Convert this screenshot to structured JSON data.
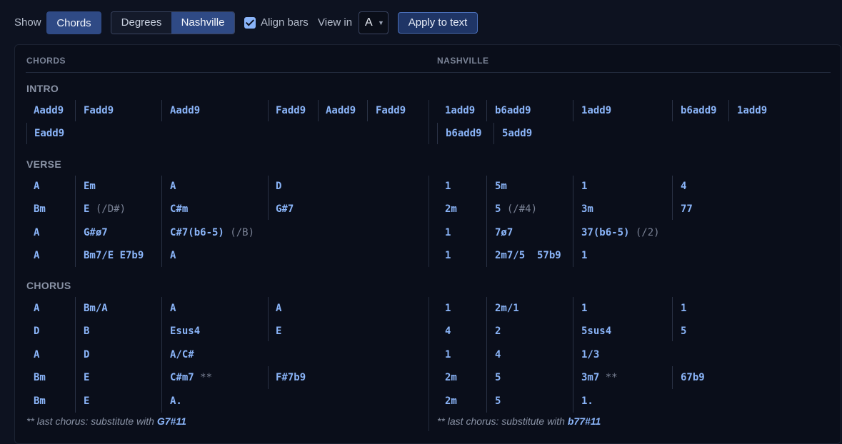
{
  "toolbar": {
    "show_label": "Show",
    "chords_button": "Chords",
    "degrees_button": "Degrees",
    "nashville_button": "Nashville",
    "align_bars_label": "Align bars",
    "align_bars_checked": true,
    "view_in_label": "View in",
    "view_in_value": "A",
    "apply_button": "Apply to text"
  },
  "columns": {
    "left": "CHORDS",
    "right": "NASHVILLE"
  },
  "sections": {
    "intro": "INTRO",
    "verse": "VERSE",
    "chorus": "CHORUS"
  },
  "chords": {
    "intro": [
      [
        "Aadd9",
        "Fadd9",
        "Aadd9",
        "Fadd9",
        "Aadd9",
        "Fadd9"
      ],
      [
        "Eadd9"
      ]
    ],
    "verse": [
      [
        "A",
        "Em",
        "A",
        "D"
      ],
      [
        "Bm",
        "E",
        "(/D#)",
        "C#m",
        "G#7"
      ],
      [
        "A",
        "G#ø7",
        "C#7(b6-5)",
        "(/B)"
      ],
      [
        "A",
        "Bm7/E  E7b9",
        "A"
      ]
    ],
    "chorus": [
      [
        "A",
        "Bm/A",
        "A",
        "A"
      ],
      [
        "D",
        "B",
        "Esus4",
        "E"
      ],
      [
        "A",
        "D",
        "A/C#"
      ],
      [
        "Bm",
        "E",
        "C#m7",
        "**",
        "F#7b9"
      ],
      [
        "Bm",
        "E",
        "A."
      ]
    ]
  },
  "nashville": {
    "intro": [
      [
        "1add9",
        "b6add9",
        "1add9",
        "b6add9",
        "1add9"
      ],
      [
        "b6add9",
        "5add9"
      ]
    ],
    "verse": [
      [
        "1",
        "5m",
        "1",
        "4"
      ],
      [
        "2m",
        "5",
        "(/#4)",
        "3m",
        "77"
      ],
      [
        "1",
        "7ø7",
        "37(b6-5)",
        "(/2)"
      ],
      [
        "1",
        "2m7/5  57b9",
        "1"
      ]
    ],
    "chorus": [
      [
        "1",
        "2m/1",
        "1",
        "1"
      ],
      [
        "4",
        "2",
        "5sus4",
        "5"
      ],
      [
        "1",
        "4",
        "1/3"
      ],
      [
        "2m",
        "5",
        "3m7",
        "**",
        "67b9"
      ],
      [
        "2m",
        "5",
        "1."
      ]
    ]
  },
  "footnotes": {
    "left_text": "** last chorus: substitute with ",
    "left_chord": "G7#11",
    "right_text": "** last chorus: substitute with ",
    "right_chord": "b77#11"
  }
}
